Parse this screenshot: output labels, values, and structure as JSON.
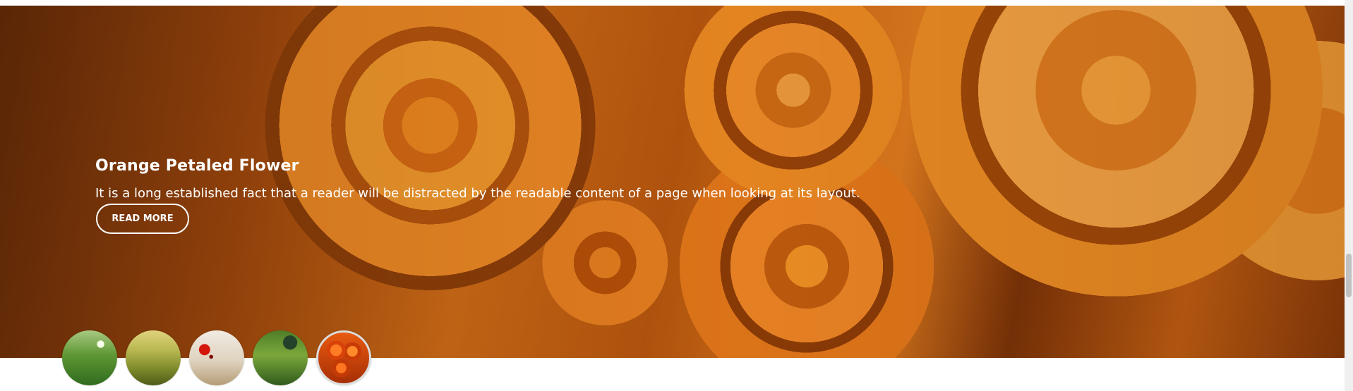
{
  "slide": {
    "title": "Orange Petaled Flower",
    "text": "It is a long established fact that a reader will be distracted by the readable content of a page when looking at its layout.",
    "button": "READ MORE"
  },
  "thumbnails": [
    {
      "name": "green grass thumbnail"
    },
    {
      "name": "yellow field thumbnail"
    },
    {
      "name": "red poppy thumbnail"
    },
    {
      "name": "green meadow thumbnail"
    },
    {
      "name": "orange roses thumbnail",
      "active": true
    }
  ],
  "colors": {
    "hero_primary": "#e37d1f",
    "hero_shadow": "#6a2d07",
    "text": "#ffffff",
    "active_thumb_border": "#dcdcdc"
  }
}
